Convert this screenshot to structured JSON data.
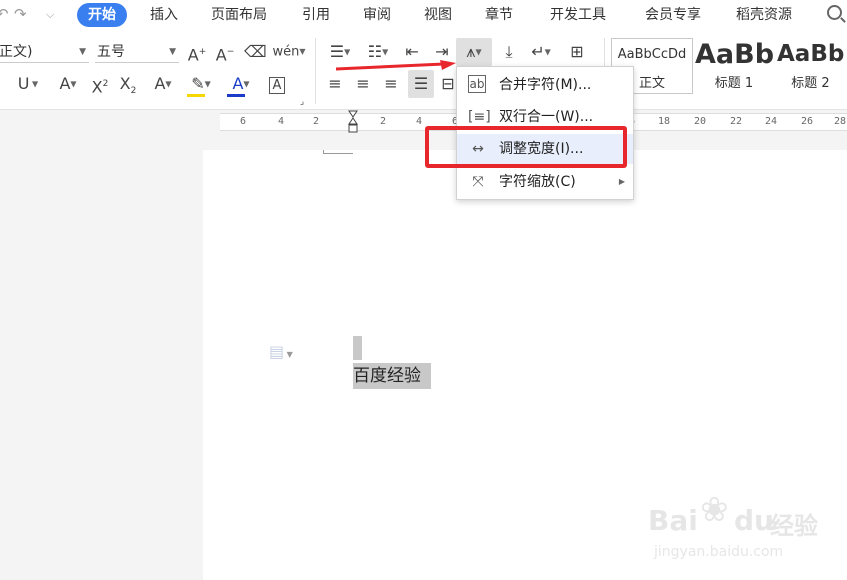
{
  "quick_access": {
    "redo_icon": "redo-icon",
    "more_icon": "chevron-down-icon"
  },
  "tabs": [
    {
      "label": "开始",
      "active": true
    },
    {
      "label": "插入"
    },
    {
      "label": "页面布局"
    },
    {
      "label": "引用"
    },
    {
      "label": "审阅"
    },
    {
      "label": "视图"
    },
    {
      "label": "章节"
    },
    {
      "label": "开发工具"
    },
    {
      "label": "会员专享"
    },
    {
      "label": "稻壳资源"
    }
  ],
  "ribbon": {
    "font_name": "正文)",
    "font_size": "五号",
    "styles": [
      {
        "sample": "AaBbCcDd",
        "name": "正文"
      },
      {
        "sample": "AaBb",
        "name": "标题 1"
      },
      {
        "sample": "AaBb",
        "name": "标题 2"
      }
    ]
  },
  "ruler": {
    "ticks": [
      "6",
      "4",
      "2",
      "2",
      "4",
      "6",
      "16",
      "18",
      "20",
      "22",
      "24",
      "26",
      "28"
    ]
  },
  "menu": {
    "items": [
      {
        "label": "合并字符(M)...",
        "icon": "merge-chars-icon"
      },
      {
        "label": "双行合一(W)...",
        "icon": "two-lines-in-one-icon"
      },
      {
        "label": "调整宽度(I)...",
        "icon": "adjust-width-icon"
      },
      {
        "label": "字符缩放(C)",
        "icon": "char-scale-icon",
        "submenu": true
      }
    ]
  },
  "document": {
    "text": "百度经验"
  },
  "watermark": {
    "brand": "Bai",
    "brand2": "du",
    "cn": "经验",
    "url": "jingyan.baidu.com"
  },
  "colors": {
    "accent": "#3a7ff0",
    "annotation": "#e8272c",
    "highlight": "#f5d800",
    "font_color": "#1a3cc8"
  }
}
